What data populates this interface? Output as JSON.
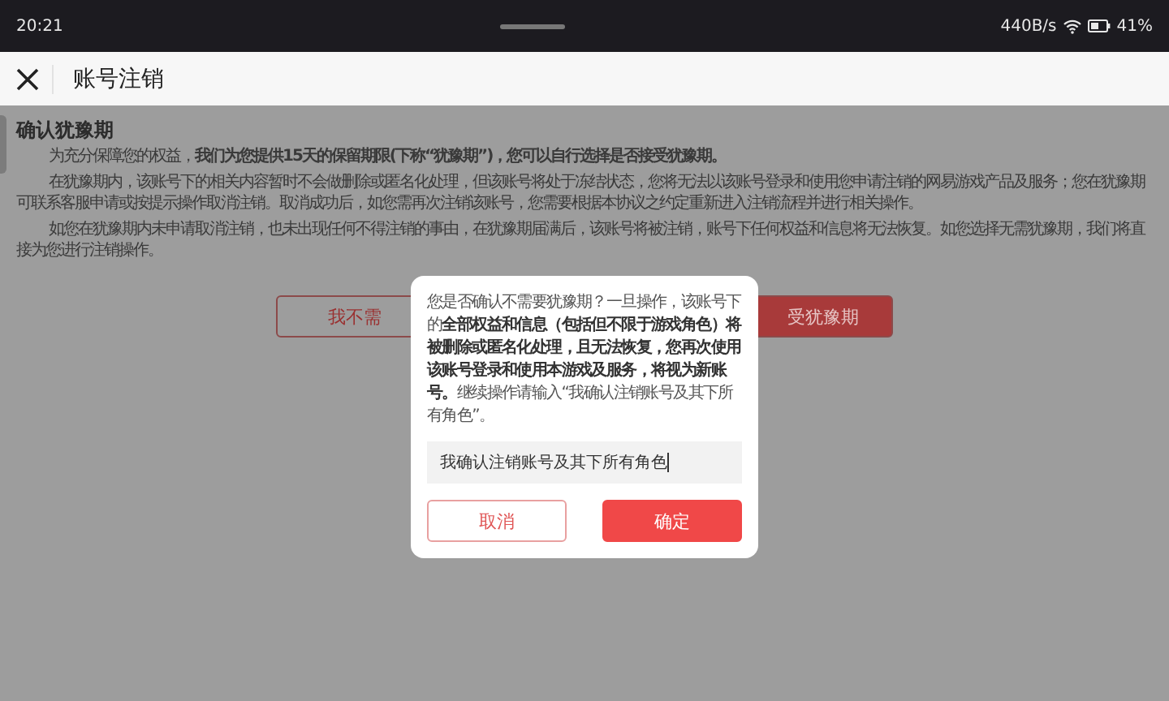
{
  "status_bar": {
    "time": "20:21",
    "speed": "440B/s",
    "battery": "41%"
  },
  "header": {
    "title": "账号注销"
  },
  "content": {
    "title": "确认犹豫期",
    "paragraphs": [
      "为充分保障您的权益，**我们为您提供15天的保留期限(下称“犹豫期”)，您可以自行选择是否接受犹豫期。**",
      "在犹豫期内，该账号下的相关内容暂时不会做删除或匿名化处理，但该账号将处于冻结状态，您将无法以该账号登录和使用您申请注销的网易游戏产品及服务；您在犹豫期可联系客服申请或按提示操作取消注销。取消成功后，如您需再次注销该账号，您需要根据本协议之约定重新进入注销流程并进行相关操作。",
      "如您在犹豫期内未申请取消注销，也未出现任何不得注销的事由，在犹豫期届满后，该账号将被注销，账号下任何权益和信息将无法恢复。如您选择无需犹豫期，我们将直接为您进行注销操作。"
    ],
    "buttons": [
      "我不需",
      "受犹豫期"
    ]
  },
  "dialog": {
    "message": "您是否确认不需要犹豫期？一旦操作，该账号下的**全部权益和信息（包括但不限于游戏角色）将被删除或匿名化处理，且无法恢复，您再次使用该账号登录和使用本游戏及服务，将视为新账号。**继续操作请输入“我确认注销账号及其下所有角色”。",
    "input_value": "我确认注销账号及其下所有角色",
    "cancel": "取消",
    "confirm": "确定"
  }
}
